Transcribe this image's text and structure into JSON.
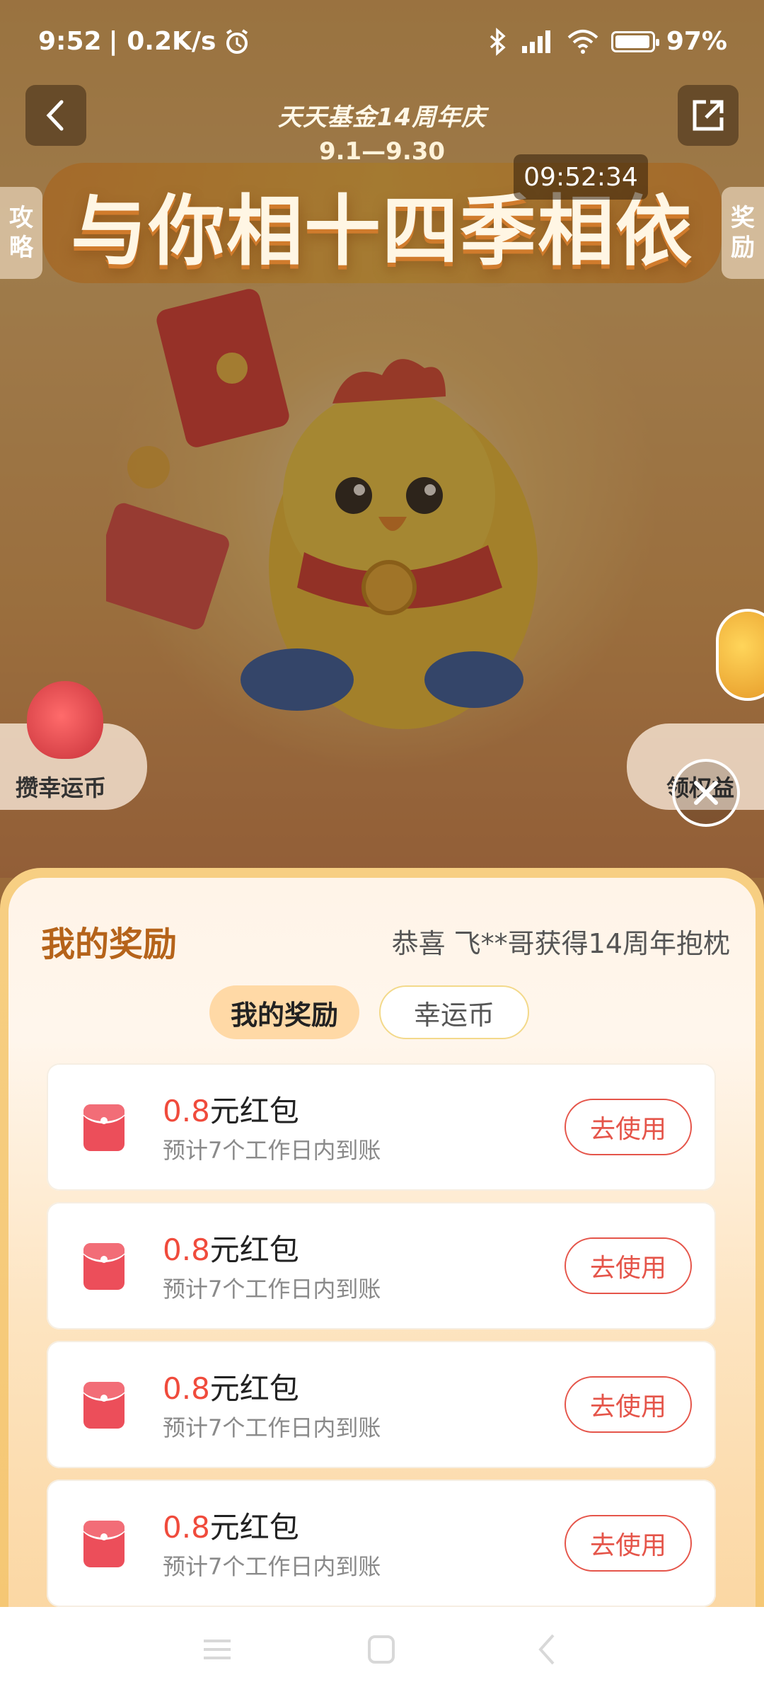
{
  "status_bar": {
    "time": "9:52",
    "speed": "| 0.2K/s",
    "battery": "97%"
  },
  "header": {
    "event_subtitle": "天天基金14周年庆",
    "event_dates": "9.1—9.30",
    "headline": "与你相十四季相依",
    "timer": "09:52:34",
    "left_tab": [
      "攻",
      "略"
    ],
    "right_tab": [
      "奖",
      "励"
    ]
  },
  "floating": {
    "left_label": "攒幸运币",
    "right_label": "领权益"
  },
  "rewards": {
    "title": "我的奖励",
    "notice": "恭喜 飞**哥获得14周年抱枕",
    "tabs": [
      {
        "label": "我的奖励",
        "active": true
      },
      {
        "label": "幸运币",
        "active": false
      }
    ],
    "items": [
      {
        "amount": "0.8",
        "unit": "元红包",
        "note": "预计7个工作日内到账",
        "button": "去使用"
      },
      {
        "amount": "0.8",
        "unit": "元红包",
        "note": "预计7个工作日内到账",
        "button": "去使用"
      },
      {
        "amount": "0.8",
        "unit": "元红包",
        "note": "预计7个工作日内到账",
        "button": "去使用"
      },
      {
        "amount": "0.8",
        "unit": "元红包",
        "note": "预计7个工作日内到账",
        "button": "去使用"
      }
    ]
  },
  "colors": {
    "accent": "#f04b3c",
    "title": "#b5631a",
    "sheet_border": "#f7cf83"
  }
}
